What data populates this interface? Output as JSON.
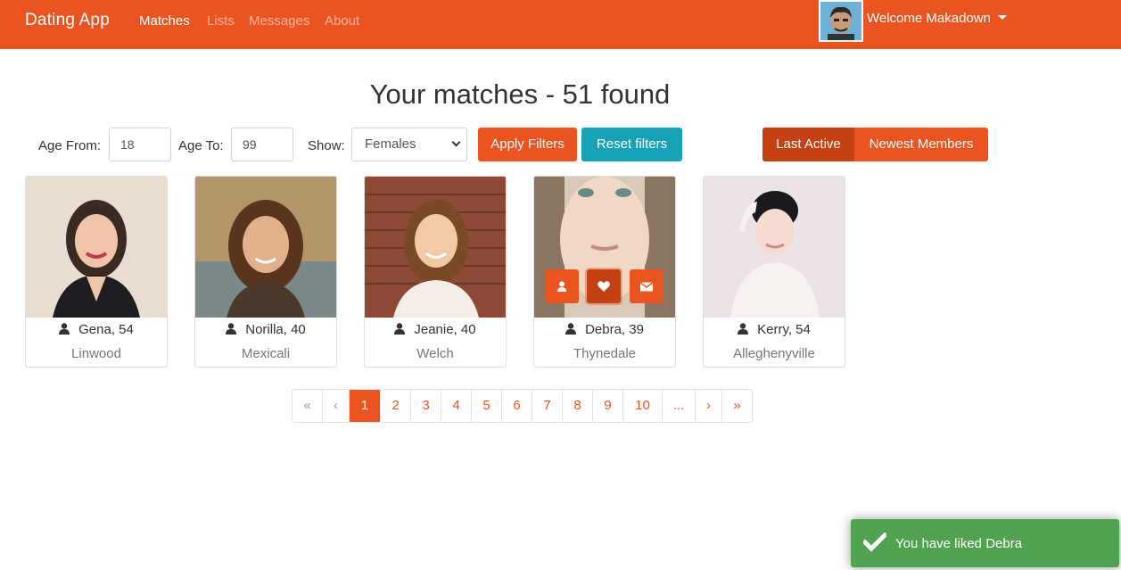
{
  "navbar": {
    "brand": "Dating App",
    "links": [
      "Matches",
      "Lists",
      "Messages",
      "About"
    ],
    "active_link": "Matches",
    "welcome": "Welcome Makadown"
  },
  "page": {
    "title": "Your matches - 51 found"
  },
  "filters": {
    "age_from_label": "Age From:",
    "age_from_value": "18",
    "age_to_label": "Age To:",
    "age_to_value": "99",
    "show_label": "Show:",
    "show_value": "Females",
    "apply_label": "Apply Filters",
    "reset_label": "Reset filters",
    "sort_last_active": "Last Active",
    "sort_newest": "Newest Members"
  },
  "members": [
    {
      "name": "Gena, 54",
      "city": "Linwood"
    },
    {
      "name": "Norilla, 40",
      "city": "Mexicali"
    },
    {
      "name": "Jeanie, 40",
      "city": "Welch"
    },
    {
      "name": "Debra, 39",
      "city": "Thynedale"
    },
    {
      "name": "Kerry, 54",
      "city": "Alleghenyville"
    }
  ],
  "pagination": {
    "first": "«",
    "prev": "‹",
    "pages": [
      "1",
      "2",
      "3",
      "4",
      "5",
      "6",
      "7",
      "8",
      "9",
      "10",
      "..."
    ],
    "next": "›",
    "last": "»",
    "current": "1"
  },
  "toast": {
    "message": "You have liked Debra"
  },
  "colors": {
    "primary": "#e95420",
    "primary_dark": "#c34113",
    "info": "#17a2b8",
    "success": "#51a351"
  },
  "icons": {
    "user": "user-icon",
    "heart": "heart-icon",
    "envelope": "envelope-icon",
    "check": "check-icon"
  }
}
